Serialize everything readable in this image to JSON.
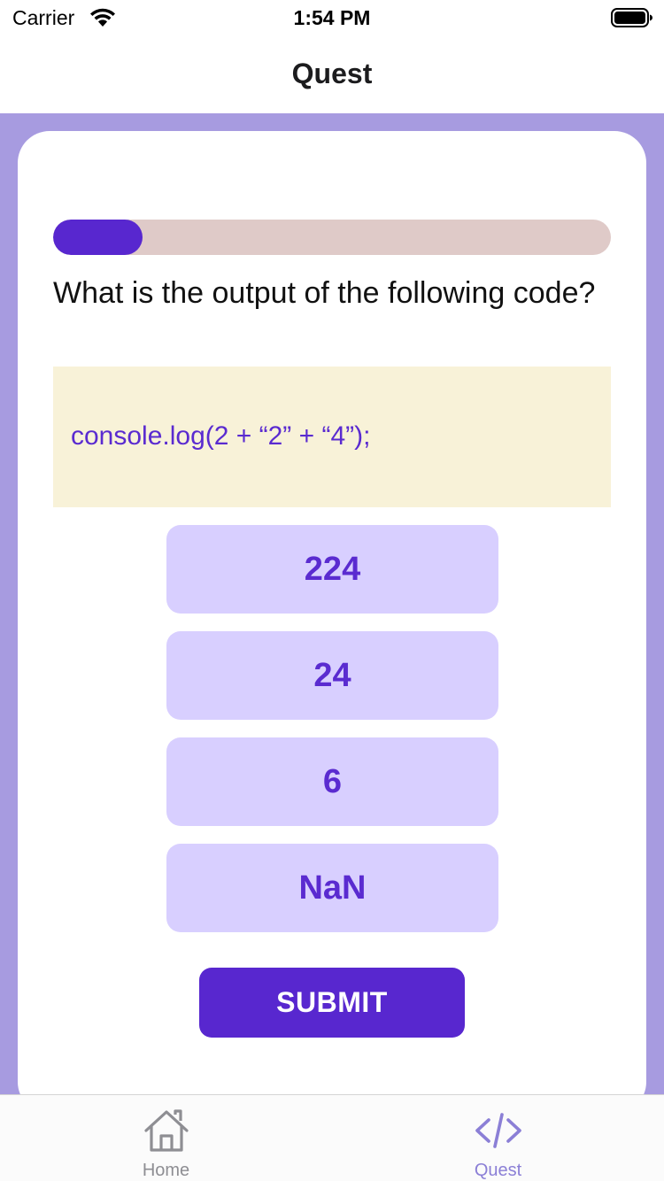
{
  "status_bar": {
    "carrier": "Carrier",
    "time": "1:54 PM"
  },
  "nav": {
    "title": "Quest"
  },
  "quiz": {
    "progress_fraction": 0.16,
    "question": "What is the output of the following code?",
    "code": "console.log(2 + “2” + “4”);",
    "options": [
      {
        "label": "224"
      },
      {
        "label": "24"
      },
      {
        "label": "6"
      },
      {
        "label": "NaN"
      }
    ],
    "submit_label": "SUBMIT"
  },
  "tab_bar": {
    "items": [
      {
        "label": "Home",
        "icon": "house-icon",
        "active": false
      },
      {
        "label": "Quest",
        "icon": "code-icon",
        "active": true
      }
    ]
  },
  "colors": {
    "accent": "#5827cf",
    "background": "#a79be0",
    "option_bg": "#d8cfff",
    "code_bg": "#f8f2d8",
    "progress_track": "#dfcac8"
  }
}
